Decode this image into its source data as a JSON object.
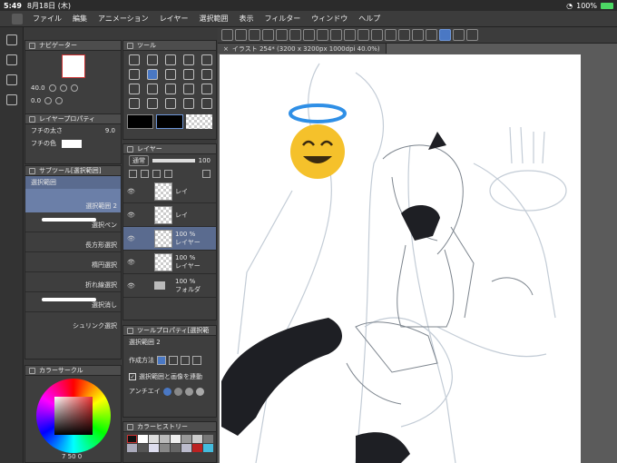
{
  "statusbar": {
    "time": "5:49",
    "date": "8月18日 (木)",
    "battery": "100%"
  },
  "menu": [
    "ファイル",
    "編集",
    "アニメーション",
    "レイヤー",
    "選択範囲",
    "表示",
    "フィルター",
    "ウィンドウ",
    "ヘルプ"
  ],
  "navigator": {
    "title": "ナビゲーター",
    "zoom": "40.0",
    "rotate": "0.0"
  },
  "layer_property": {
    "title": "レイヤープロパティ",
    "border_width_label": "フチの太さ",
    "border_width_value": "9.0",
    "border_color_label": "フチの色"
  },
  "subtool": {
    "title": "サブツール[選択範囲]",
    "group": "選択範囲",
    "items": [
      "選択範囲 2",
      "選択ペン",
      "長方形選択",
      "楕円選択",
      "折れ線選択",
      "選択消し",
      "シュリンク選択"
    ]
  },
  "tool_panel": {
    "title": "ツール"
  },
  "layer_panel": {
    "title": "レイヤー",
    "blend_mode": "通常",
    "opacity": "100",
    "layers": [
      {
        "opacity": "",
        "name": "レイ"
      },
      {
        "opacity": "",
        "name": "レイ"
      },
      {
        "opacity": "100 %",
        "name": "レイヤー"
      },
      {
        "opacity": "100 %",
        "name": "レイヤー"
      },
      {
        "opacity": "100 %",
        "name": "フォルダ"
      }
    ]
  },
  "tool_property": {
    "title": "ツールプロパティ[選択範",
    "subtool_name": "選択範囲 2",
    "method_label": "作成方法",
    "checkbox_label": "選択範囲と画像を連動",
    "antialias_label": "アンチエイ"
  },
  "color_circle": {
    "title": "カラーサークル",
    "readout": "7 50 0"
  },
  "color_history": {
    "title": "カラーヒストリー"
  },
  "doc_tab": {
    "title": "イラスト 254* (3200 x 3200px 1000dpi 40.0%)"
  },
  "colors": {
    "accent": "#4a78c4",
    "selected": "#5a6b8f",
    "halo": "#2f8fe6",
    "emoji": "#f5c12b"
  }
}
